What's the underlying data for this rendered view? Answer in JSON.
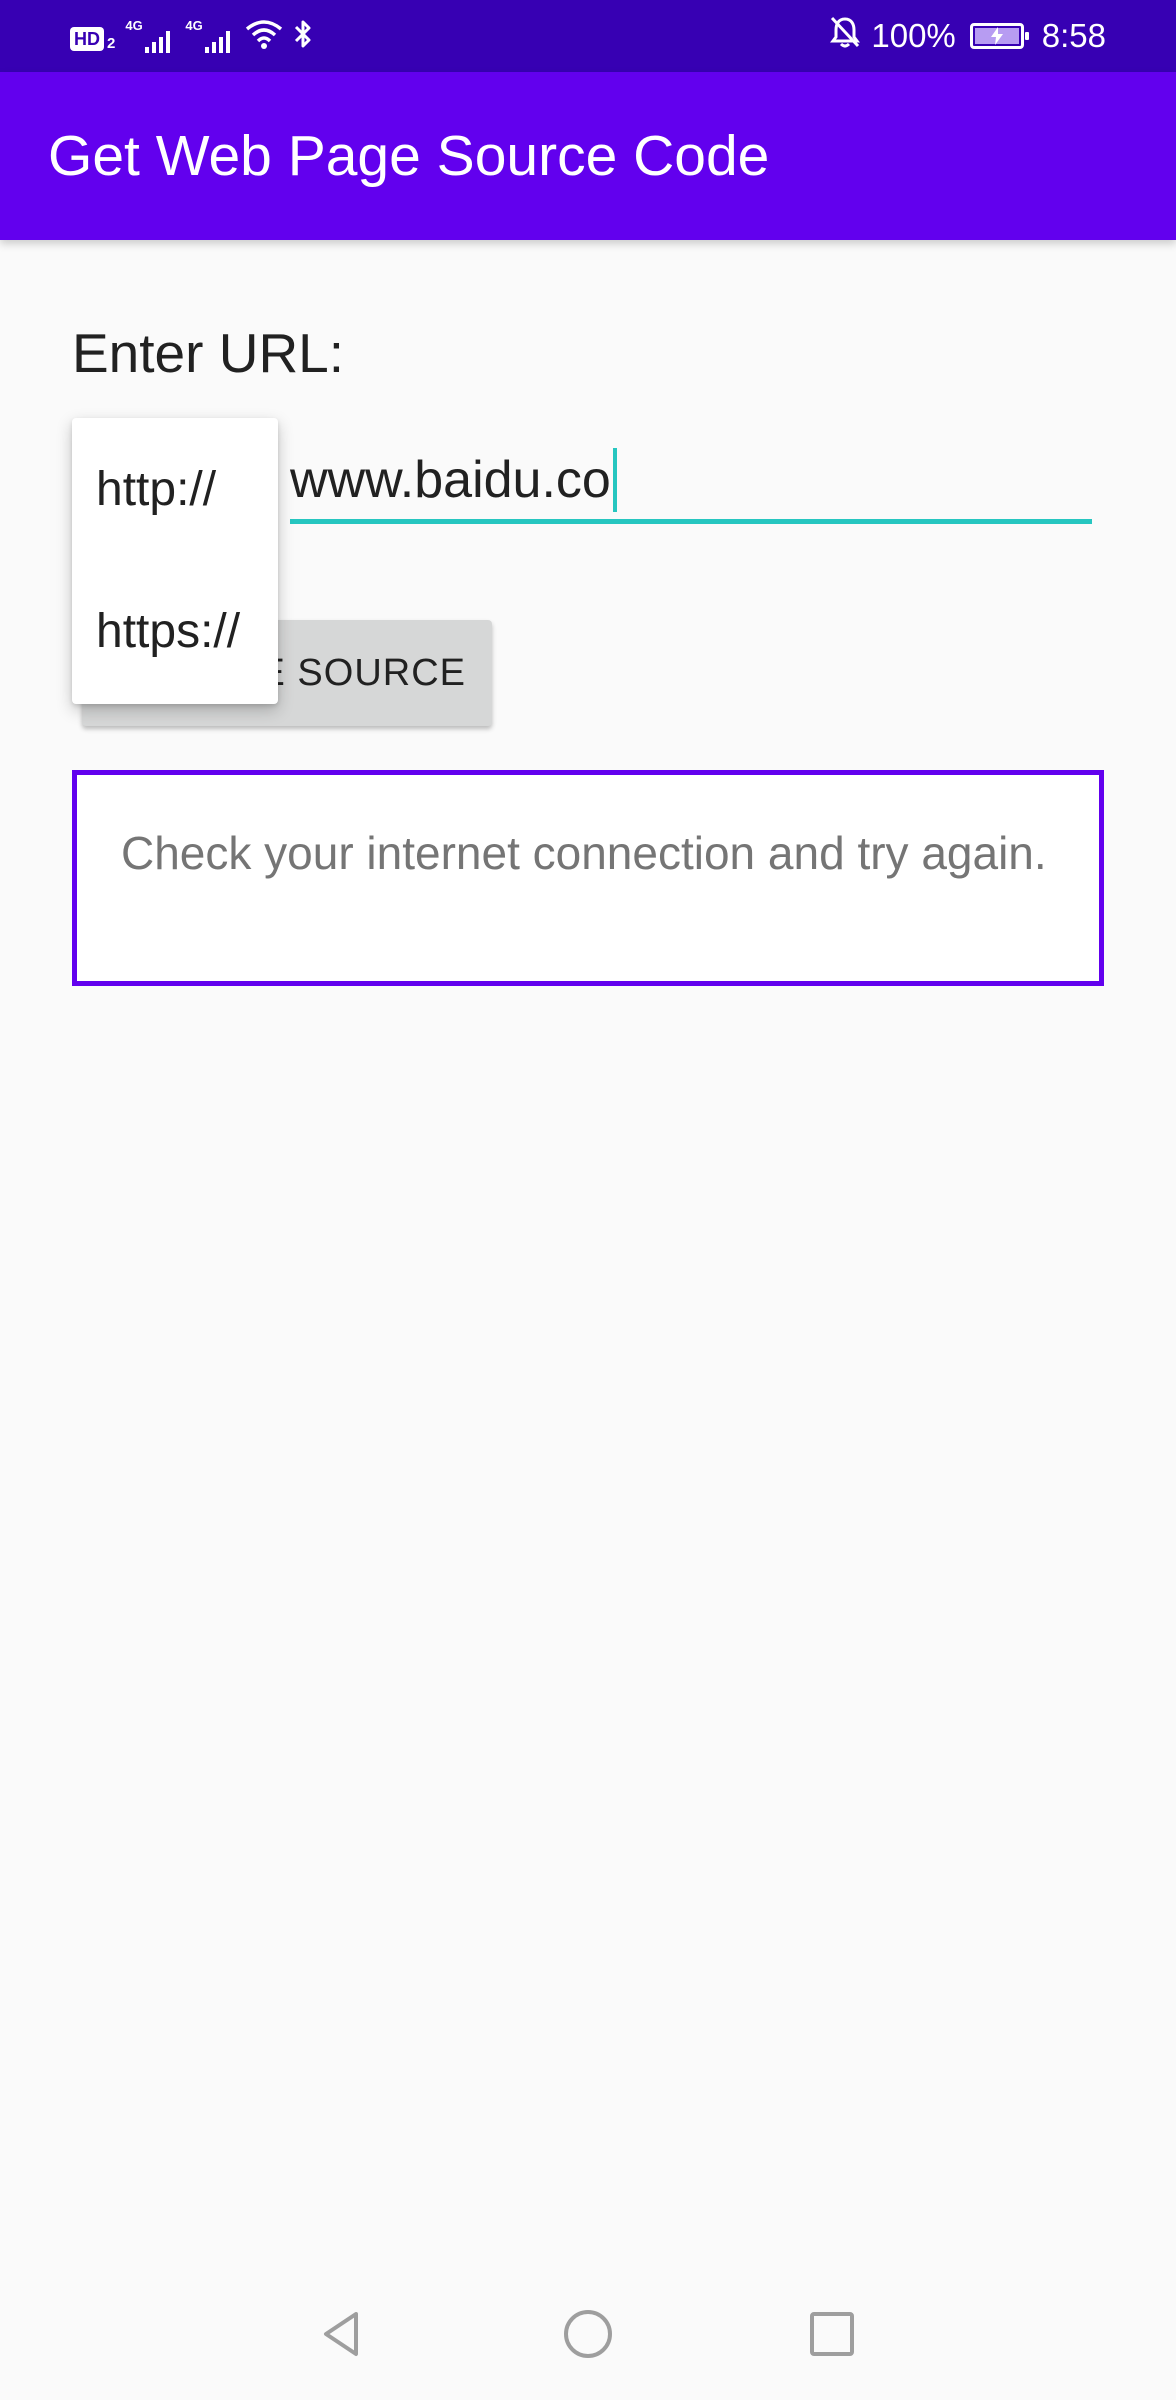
{
  "status_bar": {
    "hd_label": "HD",
    "hd_sub": "2",
    "network_1": "4G",
    "network_2": "4G",
    "battery_percent": "100%",
    "time": "8:58",
    "icons": [
      "signal-icon",
      "wifi-icon",
      "bluetooth-icon",
      "bell-off-icon",
      "battery-charging-icon"
    ]
  },
  "app_bar": {
    "title": "Get Web Page Source Code",
    "color": "#6200ee"
  },
  "form": {
    "url_label": "Enter URL:",
    "url_value": "www.baidu.co",
    "view_source_button": "E SOURCE",
    "accent_color": "#26c6c0"
  },
  "dropdown": {
    "options": [
      "http://",
      "https://"
    ]
  },
  "result": {
    "message": "Check your internet connection and try again.",
    "border_color": "#6200ee"
  },
  "nav_bar": {
    "icons": [
      "back-icon",
      "home-icon",
      "recents-icon"
    ]
  }
}
